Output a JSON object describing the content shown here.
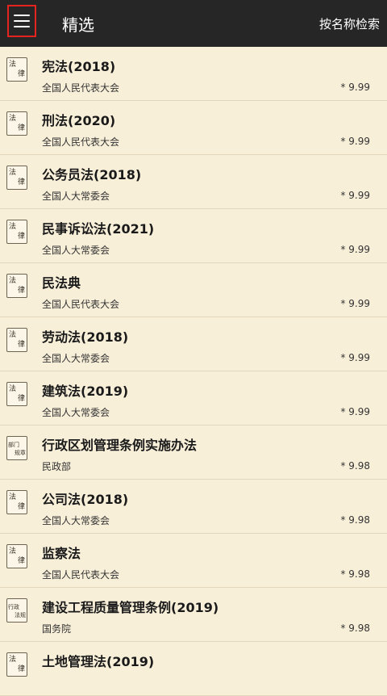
{
  "header": {
    "title": "精选",
    "search_label": "按名称检索",
    "menu_icon": "hamburger-menu-icon"
  },
  "items": [
    {
      "badge": [
        "法",
        "律"
      ],
      "name": "宪法(2018)",
      "issuer": "全国人民代表大会",
      "score": "* 9.99"
    },
    {
      "badge": [
        "法",
        "律"
      ],
      "name": "刑法(2020)",
      "issuer": "全国人民代表大会",
      "score": "* 9.99"
    },
    {
      "badge": [
        "法",
        "律"
      ],
      "name": "公务员法(2018)",
      "issuer": "全国人大常委会",
      "score": "* 9.99"
    },
    {
      "badge": [
        "法",
        "律"
      ],
      "name": "民事诉讼法(2021)",
      "issuer": "全国人大常委会",
      "score": "* 9.99"
    },
    {
      "badge": [
        "法",
        "律"
      ],
      "name": "民法典",
      "issuer": "全国人民代表大会",
      "score": "* 9.99"
    },
    {
      "badge": [
        "法",
        "律"
      ],
      "name": "劳动法(2018)",
      "issuer": "全国人大常委会",
      "score": "* 9.99"
    },
    {
      "badge": [
        "法",
        "律"
      ],
      "name": "建筑法(2019)",
      "issuer": "全国人大常委会",
      "score": "* 9.99"
    },
    {
      "badge": [
        "部门",
        "规章"
      ],
      "name": "行政区划管理条例实施办法",
      "issuer": "民政部",
      "score": "* 9.98"
    },
    {
      "badge": [
        "法",
        "律"
      ],
      "name": "公司法(2018)",
      "issuer": "全国人大常委会",
      "score": "* 9.98"
    },
    {
      "badge": [
        "法",
        "律"
      ],
      "name": "监察法",
      "issuer": "全国人民代表大会",
      "score": "* 9.98"
    },
    {
      "badge": [
        "行政",
        "法规"
      ],
      "name": "建设工程质量管理条例(2019)",
      "issuer": "国务院",
      "score": "* 9.98"
    },
    {
      "badge": [
        "法",
        "律"
      ],
      "name": "土地管理法(2019)",
      "issuer": "",
      "score": ""
    }
  ]
}
